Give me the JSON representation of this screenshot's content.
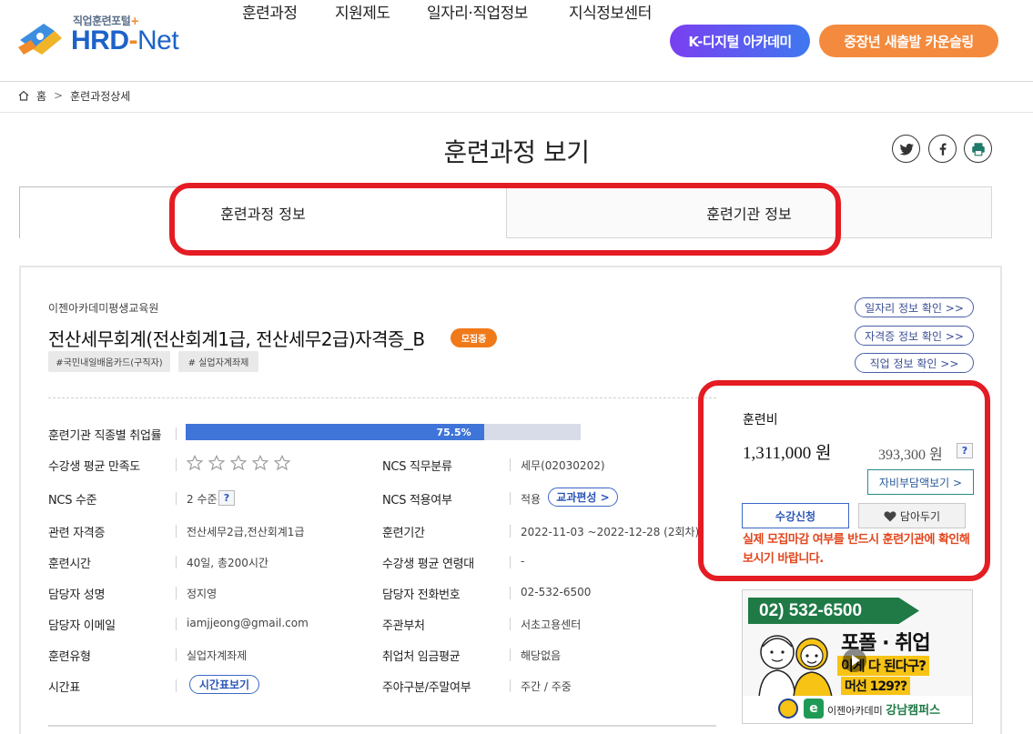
{
  "header": {
    "logo_sub": "직업훈련포털",
    "logo_plus": "+",
    "logo_hrd": "HRD",
    "logo_dash": "-",
    "logo_net": "Net",
    "nav": [
      "훈련과정",
      "지원제도",
      "일자리·직업정보",
      "지식정보센터"
    ],
    "kdigital": "K-디지털 아카데미",
    "counsel": "중장년 새출발 카운슬링"
  },
  "breadcrumb": {
    "home": "홈",
    "sep": ">",
    "current": "훈련과정상세"
  },
  "page": {
    "title": "훈련과정 보기"
  },
  "tabs": {
    "course": "훈련과정 정보",
    "institution": "훈련기관 정보"
  },
  "course": {
    "institution": "이젠아카데미평생교육원",
    "title": "전산세무회계(전산회계1급, 전산세무2급)자격증_B",
    "status_badge": "모집중",
    "tags": [
      "#국민내일배움카드(구직자)",
      "# 실업자계좌제"
    ],
    "links": [
      "일자리 정보 확인 >>",
      "자격증 정보 확인 >>",
      "직업 정보 확인 >>"
    ]
  },
  "details": {
    "employment_rate_label": "훈련기관 직종별 취업률",
    "employment_rate_value": "75.5%",
    "employment_rate": 75.5,
    "satisfaction_label": "수강생 평균 만족도",
    "rating": 0,
    "ncs_job_label": "NCS 직무분류",
    "ncs_job_value": "세무(02030202)",
    "ncs_level_label": "NCS 수준",
    "ncs_level_value": "2 수준",
    "help": "?",
    "ncs_apply_label": "NCS 적용여부",
    "ncs_apply_value": "적용",
    "curriculum_btn": "교과편성 >",
    "cert_label": "관련 자격증",
    "cert_value": "전산세무2급,전산회계1급",
    "period_label": "훈련기간",
    "period_value": "2022-11-03 ~2022-12-28 (2회차)",
    "hours_label": "훈련시간",
    "hours_value": "40일, 총200시간",
    "age_label": "수강생 평균 연령대",
    "age_value": "-",
    "manager_label": "담당자 성명",
    "manager_value": "정지영",
    "phone_label": "담당자 전화번호",
    "phone_value": "02-532-6500",
    "email_label": "담당자 이메일",
    "email_value": "iamjjeong@gmail.com",
    "dept_label": "주관부처",
    "dept_value": "서초고용센터",
    "type_label": "훈련유형",
    "type_value": "실업자계좌제",
    "wage_label": "취업처 임금평균",
    "wage_value": "해당없음",
    "schedule_label": "시간표",
    "schedule_btn": "시간표보기",
    "daynight_label": "주야구분/주말여부",
    "daynight_value": "주간 / 주중"
  },
  "fee": {
    "label": "훈련비",
    "total": "1,311,000 원",
    "self": "393,300 원",
    "help": "?",
    "self_btn": "자비부담액보기 >",
    "apply_btn": "수강신청",
    "wish_btn": "담아두기",
    "notice": "실제 모집마감 여부를 반드시 훈련기관에 확인해보시기 바랍니다."
  },
  "banner": {
    "phone": "02) 532-6500",
    "big": "포폴 · 취업",
    "line1": "이게 다 된다구?",
    "line2": "머선 129??",
    "foot_a": "이젠아카데미",
    "foot_b": "강남캠퍼스"
  },
  "colors": {
    "accent_blue": "#3f74d8",
    "highlight_red": "#e41c23",
    "recruit_orange": "#f07a1a",
    "notice_orange": "#e2461d",
    "counsel_orange": "#f48a3d",
    "kdigital_purple": "#7a3ff0"
  }
}
